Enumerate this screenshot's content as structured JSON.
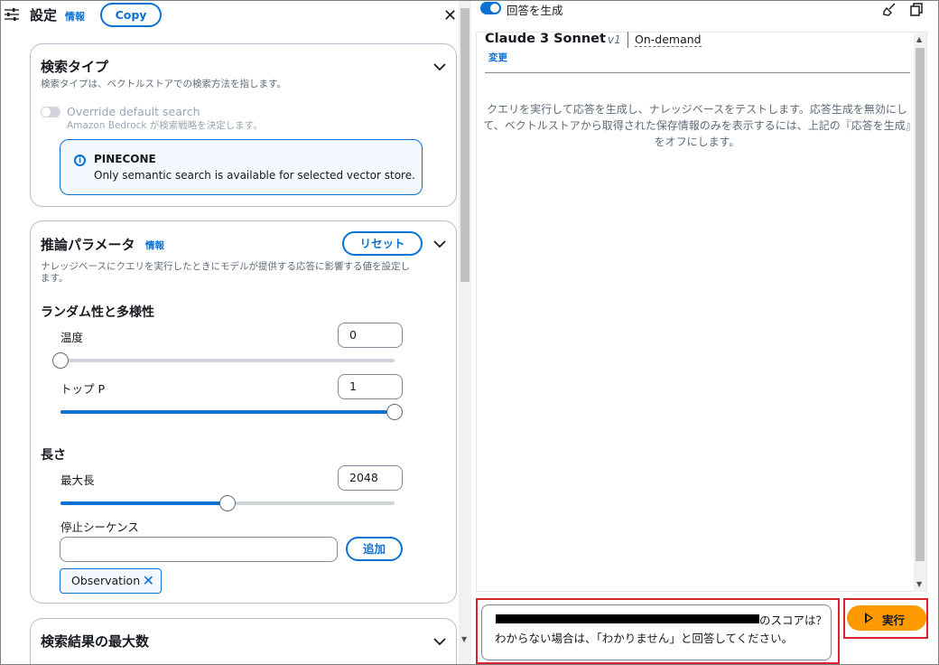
{
  "settings": {
    "title": "設定",
    "info_link": "情報",
    "copy_label": "Copy",
    "close_symbol": "✕"
  },
  "search_type": {
    "heading": "検索タイプ",
    "description": "検索タイプは、ベクトルストアでの検索方法を指します。",
    "override_label": "Override default search",
    "override_desc": "Amazon Bedrock が検索戦略を決定します。",
    "override_enabled": false,
    "alert_title": "PINECONE",
    "alert_message": "Only semantic search is available for selected vector store."
  },
  "inference": {
    "heading": "推論パラメータ",
    "info_link": "情報",
    "reset_label": "リセット",
    "description_line1": "ナレッジベースにクエリを実行したときにモデルが提供する応答に影響する値を設定し",
    "description_line2": "ます。",
    "randomness_heading": "ランダム性と多様性",
    "temperature_label": "温度",
    "temperature_value": "0",
    "temperature_fraction": 0,
    "top_p_label": "トップ P",
    "top_p_value": "1",
    "top_p_fraction": 1,
    "length_heading": "長さ",
    "max_length_label": "最大長",
    "max_length_value": "2048",
    "max_length_fraction": 0.5,
    "stop_sequence_label": "停止シーケンス",
    "stop_sequence_input": "",
    "add_label": "追加",
    "stop_tokens": [
      "Observation"
    ]
  },
  "max_results": {
    "heading": "検索結果の最大数"
  },
  "generate": {
    "toggle_label": "回答を生成",
    "enabled": true
  },
  "model": {
    "name": "Claude 3 Sonnet",
    "version": "v1",
    "throughput": "On-demand",
    "change_label": "変更"
  },
  "empty_state": "クエリを実行して応答を生成し、ナレッジベースをテストします。応答生成を無効にして、ベクトルストアから取得された保存情報のみを表示するには、上記の『応答を生成』をオフにします。",
  "query": {
    "line1_suffix": "のスコアは？",
    "line2": "わからない場合は、「わかりません」と回答してください。"
  },
  "run_label": "実行",
  "colors": {
    "accent": "#0972d3",
    "run_button": "#ff9900",
    "highlight_border": "#d9232e"
  },
  "icons": [
    "settings-sliders-icon",
    "close-icon",
    "chevron-down-icon",
    "info-icon",
    "remove-token-icon",
    "clear-broom-icon",
    "copy-icon",
    "play-icon"
  ]
}
